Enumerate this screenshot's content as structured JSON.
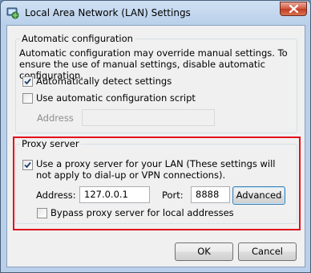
{
  "window": {
    "title": "Local Area Network (LAN) Settings",
    "icon": "network-globe-icon",
    "close_icon": "close-icon"
  },
  "automatic_configuration": {
    "legend": "Automatic configuration",
    "description": "Automatic configuration may override manual settings.  To ensure the use of manual settings, disable automatic configuration.",
    "auto_detect": {
      "label": "Automatically detect settings",
      "checked": true
    },
    "use_script": {
      "label": "Use automatic configuration script",
      "checked": false
    },
    "address_label": "Address",
    "address_value": ""
  },
  "proxy_server": {
    "legend": "Proxy server",
    "use_proxy": {
      "label": "Use a proxy server for your LAN (These settings will not apply to dial-up or VPN connections).",
      "checked": true
    },
    "address_label": "Address:",
    "address_value": "127.0.0.1",
    "port_label": "Port:",
    "port_value": "8888",
    "advanced_label": "Advanced",
    "bypass_local": {
      "label": "Bypass proxy server for local addresses",
      "checked": false
    }
  },
  "buttons": {
    "ok_label": "OK",
    "cancel_label": "Cancel"
  },
  "colors": {
    "highlight_border": "#e3101c",
    "title_bar": "#b9d0ea",
    "dialog_background": "#f0f0f0"
  }
}
